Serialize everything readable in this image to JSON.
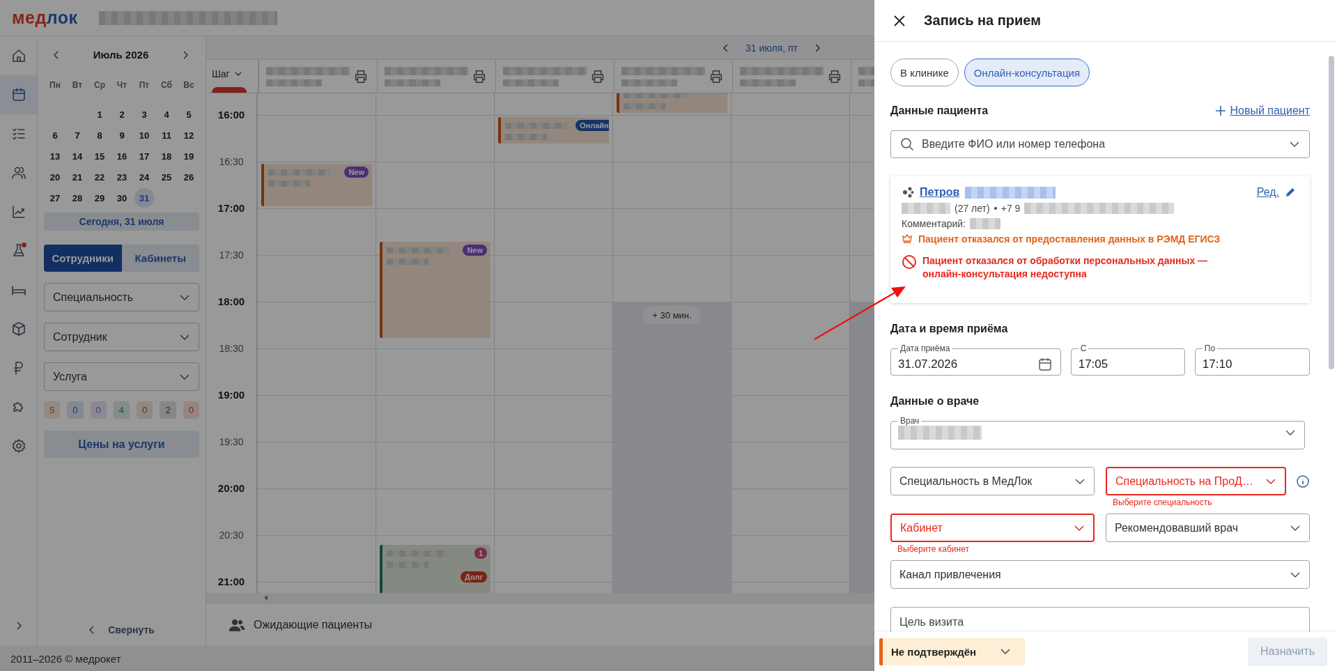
{
  "header": {
    "logo": {
      "first": "мед",
      "second": "лок"
    }
  },
  "rail": {
    "items": [
      {
        "kind": "home",
        "selected": false,
        "alert": false
      },
      {
        "kind": "calendar",
        "selected": true,
        "alert": false
      },
      {
        "kind": "tasks",
        "selected": false,
        "alert": false
      },
      {
        "kind": "people",
        "selected": false,
        "alert": false
      },
      {
        "kind": "chart",
        "selected": false,
        "alert": false
      },
      {
        "kind": "lab",
        "selected": false,
        "alert": true
      },
      {
        "kind": "bed",
        "selected": false,
        "alert": false
      },
      {
        "kind": "box",
        "selected": false,
        "alert": false
      },
      {
        "kind": "ruble",
        "selected": false,
        "alert": false
      },
      {
        "kind": "puzzle",
        "selected": false,
        "alert": false
      },
      {
        "kind": "settings",
        "selected": false,
        "alert": false
      }
    ]
  },
  "sidebar": {
    "month": "Июль 2026",
    "weekdays": [
      "Пн",
      "Вт",
      "Ср",
      "Чт",
      "Пт",
      "Сб",
      "Вс"
    ],
    "weeks": [
      [
        {
          "label": "1",
          "selected": false
        },
        {
          "label": "2",
          "selected": false
        },
        {
          "label": "3",
          "selected": false
        },
        {
          "label": "4",
          "selected": false
        },
        {
          "label": "5",
          "selected": false
        }
      ],
      [
        {
          "label": "6",
          "selected": false
        },
        {
          "label": "7",
          "selected": false
        },
        {
          "label": "8",
          "selected": false
        },
        {
          "label": "9",
          "selected": false
        },
        {
          "label": "10",
          "selected": false
        },
        {
          "label": "11",
          "selected": false
        },
        {
          "label": "12",
          "selected": false
        }
      ],
      [
        {
          "label": "13",
          "selected": false
        },
        {
          "label": "14",
          "selected": false
        },
        {
          "label": "15",
          "selected": false
        },
        {
          "label": "16",
          "selected": false
        },
        {
          "label": "17",
          "selected": false
        },
        {
          "label": "18",
          "selected": false
        },
        {
          "label": "19",
          "selected": false
        }
      ],
      [
        {
          "label": "20",
          "selected": false
        },
        {
          "label": "21",
          "selected": false
        },
        {
          "label": "22",
          "selected": false
        },
        {
          "label": "23",
          "selected": false
        },
        {
          "label": "24",
          "selected": false
        },
        {
          "label": "25",
          "selected": false
        },
        {
          "label": "26",
          "selected": false
        }
      ],
      [
        {
          "label": "27",
          "selected": false
        },
        {
          "label": "28",
          "selected": false
        },
        {
          "label": "29",
          "selected": false
        },
        {
          "label": "30",
          "selected": false
        },
        {
          "label": "31",
          "selected": true
        }
      ]
    ],
    "today_button": "Сегодня, 31 июля",
    "view_tabs": [
      {
        "label": "Сотрудники",
        "selected": true
      },
      {
        "label": "Кабинеты",
        "selected": false
      }
    ],
    "filters": [
      {
        "placeholder": "Специальность"
      },
      {
        "placeholder": "Сотрудник"
      },
      {
        "placeholder": "Услуга"
      }
    ],
    "counters": [
      {
        "value": "5",
        "kind": "orange"
      },
      {
        "value": "0",
        "kind": "blue"
      },
      {
        "value": "0",
        "kind": "purple"
      },
      {
        "value": "4",
        "kind": "green"
      },
      {
        "value": "0",
        "kind": "brown"
      },
      {
        "value": "2",
        "kind": "gray"
      },
      {
        "value": "0",
        "kind": "red"
      }
    ],
    "prices_button": "Цены на услуги",
    "collapse": "Свернуть"
  },
  "schedule": {
    "date": "31 июля, пт",
    "step_label": "Шаг",
    "times": [
      {
        "label": "16:00",
        "major": true
      },
      {
        "label": "16:30",
        "major": false
      },
      {
        "label": "17:00",
        "major": true
      },
      {
        "label": "17:30",
        "major": false
      },
      {
        "label": "18:00",
        "major": true
      },
      {
        "label": "18:30",
        "major": false
      },
      {
        "label": "19:00",
        "major": true
      },
      {
        "label": "19:30",
        "major": false
      },
      {
        "label": "20:00",
        "major": true
      },
      {
        "label": "20:30",
        "major": false
      },
      {
        "label": "21:00",
        "major": true
      }
    ],
    "columns": [
      {
        "unavailable": false,
        "events": [
          {
            "kind": "unconfirmed",
            "badges": [
              {
                "label": "New",
                "kind": "new"
              }
            ]
          }
        ]
      },
      {
        "unavailable": false,
        "events": [
          {
            "kind": "unconfirmed",
            "badges": [
              {
                "label": "New",
                "kind": "new"
              }
            ]
          },
          {
            "kind": "confirmed",
            "badges": [
              {
                "label": "1",
                "kind": "count"
              },
              {
                "label": "Долг",
                "kind": "debt"
              }
            ]
          }
        ]
      },
      {
        "unavailable": false,
        "events": [
          {
            "kind": "unconfirmed",
            "badges": [
              {
                "label": "Онлайн",
                "kind": "online"
              }
            ]
          }
        ]
      },
      {
        "unavailable": true,
        "extra_slot": "+ 30 мин.",
        "events": [
          {
            "kind": "unconfirmed"
          }
        ]
      },
      {
        "unavailable": false
      },
      {
        "unavailable": true
      }
    ],
    "waiting": "Ожидающие пациенты"
  },
  "footer": "2011–2026 © медрокет",
  "panel": {
    "title": "Запись на прием",
    "modes": [
      {
        "label": "В клинике",
        "selected": false
      },
      {
        "label": "Онлайн-консультация",
        "selected": true
      }
    ],
    "patient_title": "Данные пациента",
    "new_patient": "Новый пациент",
    "search": {
      "placeholder": "Введите ФИО или номер телефона"
    },
    "card": {
      "name": "Петров",
      "edit": "Ред.",
      "age": "(27 лет)",
      "phone": "+7 9",
      "comment": "Комментарий:",
      "notices": [
        {
          "kind": "warning",
          "text": "Пациент отказался от предоставления данных в РЭМД ЕГИСЗ"
        },
        {
          "kind": "error",
          "text": "Пациент отказался от обработки персональных данных — онлайн-консультация недоступна"
        }
      ]
    },
    "datetime_title": "Дата и время приёма",
    "datetime_fields": [
      {
        "kind": "date",
        "label": "Дата приёма",
        "value": "31.07.2026"
      },
      {
        "kind": "time",
        "label": "С",
        "value": "17:05"
      },
      {
        "kind": "time",
        "label": "По",
        "value": "17:10"
      }
    ],
    "doctor_title": "Данные о враче",
    "doctor_label": "Врач",
    "selects": [
      {
        "placeholder": "Специальность в МедЛок",
        "error": false,
        "info": false
      },
      {
        "placeholder": "Специальность на ПроД…",
        "error": true,
        "message": "Выберите специальность",
        "info": true
      },
      {
        "placeholder": "Кабинет",
        "error": true,
        "message": "Выберите кабинет",
        "info": false
      },
      {
        "placeholder": "Рекомендовавший врач",
        "error": false,
        "info": false
      }
    ],
    "channel": {
      "placeholder": "Канал привлечения"
    },
    "goal": {
      "placeholder": "Цель визита"
    },
    "status": {
      "label": "Не подтверждён"
    },
    "submit": {
      "label": "Назначить",
      "disabled": true
    }
  }
}
